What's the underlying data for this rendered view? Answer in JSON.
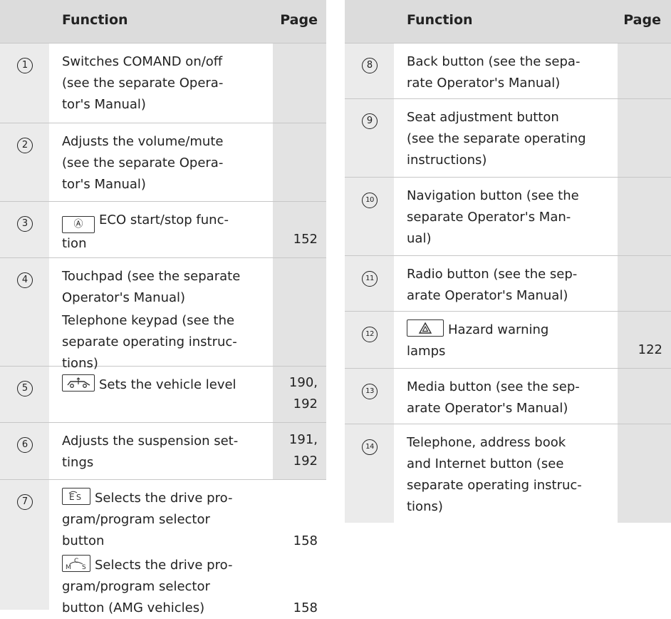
{
  "left": {
    "header": {
      "function": "Function",
      "page": "Page"
    },
    "rows": [
      {
        "num": "1",
        "text": "Switches COMAND on/off (see the separate Opera-tor's Manual)",
        "page": ""
      },
      {
        "num": "2",
        "text": "Adjusts the volume/mute (see the separate Opera-tor's Manual)",
        "page": ""
      },
      {
        "num": "3",
        "key": "Ⓐ",
        "text": "ECO start/stop func-tion",
        "page": "152"
      },
      {
        "num": "4",
        "text": "Touchpad (see the separate Operator's Manual)",
        "text2": "Telephone keypad (see the separate operating instruc-tions)",
        "page": ""
      },
      {
        "num": "5",
        "key": "vehicle-level-icon",
        "text": "Sets the vehicle level",
        "page": "190, 192"
      },
      {
        "num": "6",
        "text": "Adjusts the suspension set-tings",
        "page": "191, 192"
      },
      {
        "num": "7",
        "key": "E S",
        "text": "Selects the drive pro-gram/program selector button",
        "page": "158",
        "key2": "C M S",
        "text2": "Selects the drive pro-gram/program selector button (AMG vehicles)",
        "page2": "158"
      }
    ]
  },
  "right": {
    "header": {
      "function": "Function",
      "page": "Page"
    },
    "rows": [
      {
        "num": "8",
        "text": "Back button (see the sepa-rate Operator's Manual)",
        "page": ""
      },
      {
        "num": "9",
        "text": "Seat adjustment button (see the separate operating instructions)",
        "page": ""
      },
      {
        "num": "10",
        "text": "Navigation button (see the separate Operator's Man-ual)",
        "page": ""
      },
      {
        "num": "11",
        "text": "Radio button (see the sep-arate Operator's Manual)",
        "page": ""
      },
      {
        "num": "12",
        "key": "hazard-icon",
        "text": "Hazard warning lamps",
        "page": "122"
      },
      {
        "num": "13",
        "text": "Media button (see the sep-arate Operator's Manual)",
        "page": ""
      },
      {
        "num": "14",
        "text": "Telephone, address book and Internet button (see separate operating instruc-tions)",
        "page": ""
      }
    ]
  }
}
